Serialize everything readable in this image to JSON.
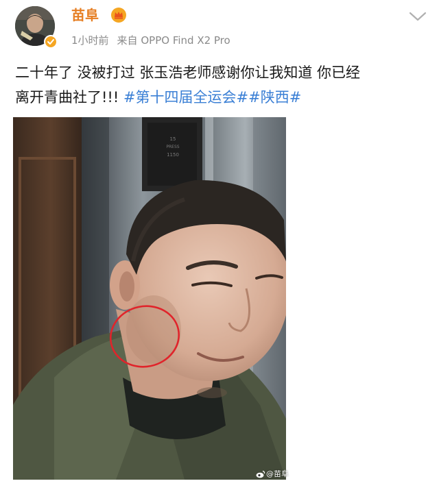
{
  "post": {
    "author": {
      "name": "苗阜",
      "avatar_icon": "avatar",
      "member_icon": "crown-icon",
      "verified_icon": "verified-check-icon",
      "name_color": "#e67e22"
    },
    "time": "1小时前",
    "source_prefix": "来自",
    "source_device": "OPPO Find X2 Pro",
    "text_line1": "二十年了 没被打过 张玉浩老师感谢你让我知道 你已经",
    "text_line2": "离开青曲社了!!!",
    "hashtags": [
      "#第十四届全运会#",
      "#陕西#"
    ],
    "hashtag_color": "#3a7fd5",
    "menu_icon": "chevron-down-icon",
    "photo": {
      "elevator_panel_text": [
        "15",
        "PRESS",
        "1150"
      ],
      "annotation": "red-circle-annotation",
      "watermark": "@苗阜",
      "watermark_icon": "weibo-logo-icon"
    }
  }
}
